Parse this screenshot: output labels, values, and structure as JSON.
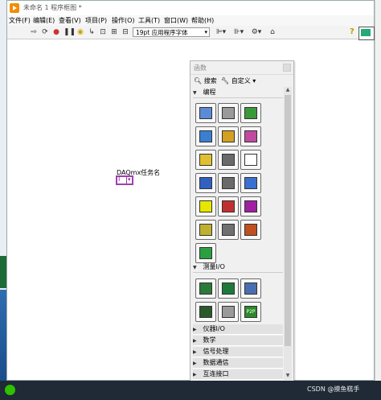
{
  "window": {
    "title": "未命名 1 程序框图 *"
  },
  "menubar": {
    "items": [
      "文件(F)",
      "编辑(E)",
      "查看(V)",
      "项目(P)",
      "操作(O)",
      "工具(T)",
      "窗口(W)",
      "帮助(H)"
    ]
  },
  "toolbar": {
    "font": "19pt 应用程序字体",
    "help": "?"
  },
  "canvas": {
    "constant_label": "DAQmx任务名",
    "constant_glyph": "I"
  },
  "palette": {
    "title": "函数",
    "search_label": "搜索",
    "custom_label": "自定义",
    "open_categories": [
      "编程",
      "测量I/O"
    ],
    "closed_categories": [
      "仪器I/O",
      "数学",
      "信号处理",
      "数据通信",
      "互连接口"
    ],
    "programming_icon_colors": [
      "#5b8bd6",
      "#9a9a9a",
      "#3a9a3a",
      "#3a7fd0",
      "#d4a020",
      "#c04aa0",
      "#e0c030",
      "#6a6a6a",
      "#ffffff",
      "#3060c0",
      "#6a6a6a",
      "#3a70d0",
      "#e6e600",
      "#c03030",
      "#a020a0",
      "#c0b030",
      "#707070",
      "#c05020",
      "#2aa040"
    ],
    "measurement_icon_labels": [
      "",
      "",
      "",
      "",
      "",
      "P2P"
    ]
  },
  "taskbar": {
    "watermark": "CSDN @摸鱼糕手"
  }
}
